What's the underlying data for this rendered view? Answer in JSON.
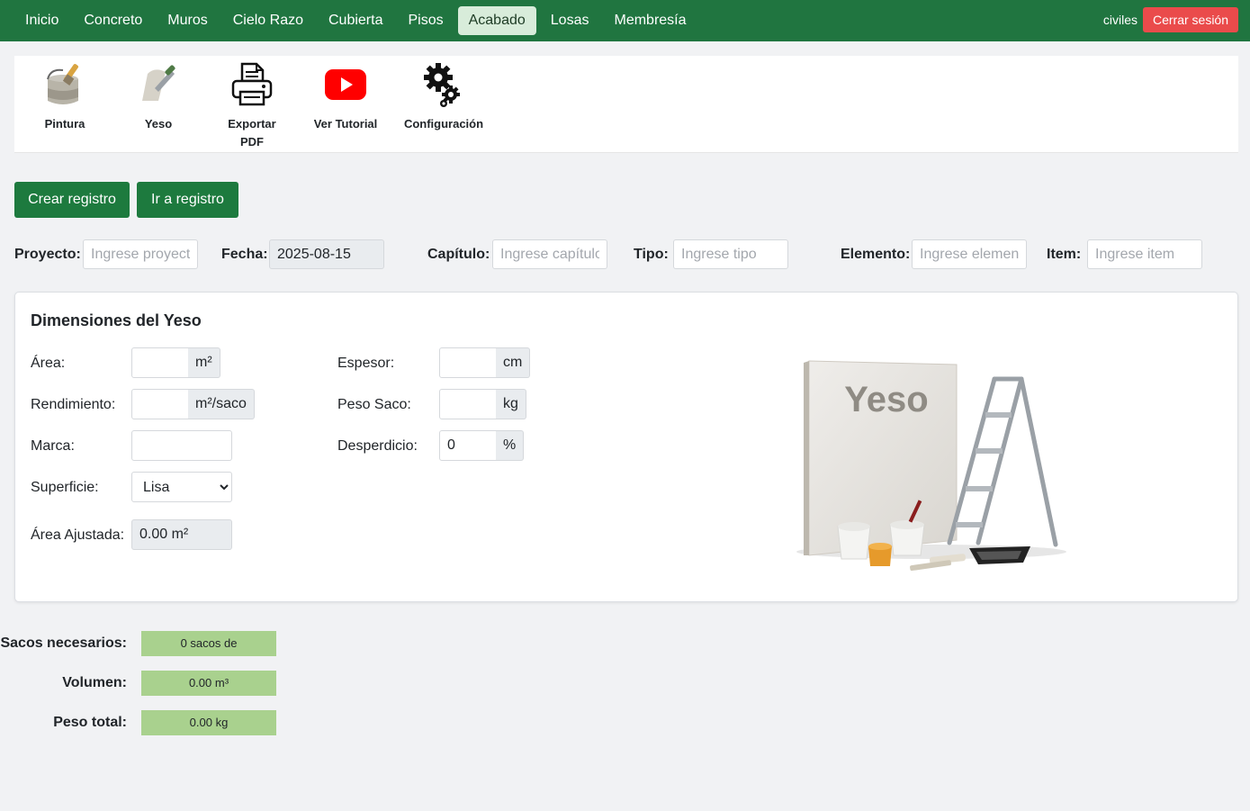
{
  "nav": {
    "items": [
      "Inicio",
      "Concreto",
      "Muros",
      "Cielo Razo",
      "Cubierta",
      "Pisos",
      "Acabado",
      "Losas",
      "Membresía"
    ],
    "active_index": 6,
    "user": "civiles",
    "logout_label": "Cerrar sesión"
  },
  "toolbar": {
    "pintura": "Pintura",
    "yeso": "Yeso",
    "exportar_line1": "Exportar",
    "exportar_line2": "PDF",
    "tutorial": "Ver Tutorial",
    "config": "Configuración"
  },
  "actions": {
    "crear": "Crear registro",
    "ir": "Ir a registro"
  },
  "meta": {
    "proyecto_label": "Proyecto:",
    "proyecto_placeholder": "Ingrese proyecto",
    "fecha_label": "Fecha:",
    "fecha_value": "2025-08-15",
    "capitulo_label": "Capítulo:",
    "capitulo_placeholder": "Ingrese capítulo",
    "tipo_label": "Tipo:",
    "tipo_placeholder": "Ingrese tipo",
    "elemento_label": "Elemento:",
    "elemento_placeholder": "Ingrese elemento",
    "item_label": "Item:",
    "item_placeholder": "Ingrese item"
  },
  "card": {
    "title": "Dimensiones del Yeso",
    "area_label": "Área:",
    "area_unit": "m²",
    "rendimiento_label": "Rendimiento:",
    "rendimiento_unit": "m²/saco",
    "marca_label": "Marca:",
    "superficie_label": "Superficie:",
    "superficie_value": "Lisa",
    "area_ajustada_label": "Área Ajustada:",
    "area_ajustada_value": "0.00 m²",
    "espesor_label": "Espesor:",
    "espesor_unit": "cm",
    "peso_saco_label": "Peso Saco:",
    "peso_saco_unit": "kg",
    "desperdicio_label": "Desperdicio:",
    "desperdicio_value": "0",
    "desperdicio_unit": "%",
    "image_text": "Yeso"
  },
  "results": {
    "sacos_label": "Sacos necesarios:",
    "sacos_value": "0 sacos de",
    "volumen_label": "Volumen:",
    "volumen_value": "0.00 m³",
    "peso_label": "Peso total:",
    "peso_value": "0.00 kg"
  },
  "colors": {
    "navbar": "#207540",
    "button_green": "#1d7a3e",
    "logout_red": "#ea4b4b",
    "result_green": "#a9d18e"
  }
}
